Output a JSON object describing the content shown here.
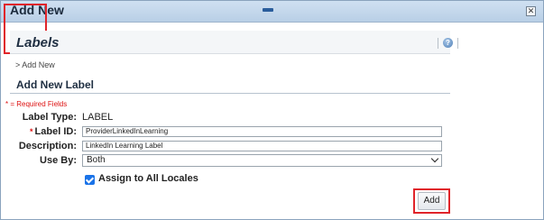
{
  "dialog": {
    "title": "Add New"
  },
  "header": {
    "title": "Labels",
    "help_icon": "help-icon"
  },
  "breadcrumb": "> Add New",
  "section": {
    "title": "Add New Label"
  },
  "form": {
    "required_note": "* = Required Fields",
    "label_type": {
      "label": "Label Type:",
      "value": "LABEL"
    },
    "label_id": {
      "required_marker": "*",
      "label": "Label ID:",
      "value": "ProviderLinkedInLearning"
    },
    "description": {
      "label": "Description:",
      "value": "LinkedIn Learning Label"
    },
    "use_by": {
      "label": "Use By:",
      "selected": "Both"
    },
    "assign_all_locales": {
      "label": "Assign to All Locales",
      "checked": true
    }
  },
  "actions": {
    "add_label": "Add",
    "close_glyph": "✕"
  },
  "colors": {
    "highlight": "#e0242a",
    "titlebar": "#b9cfe6",
    "checkbox": "#1a73e8",
    "required": "#dd1111"
  }
}
